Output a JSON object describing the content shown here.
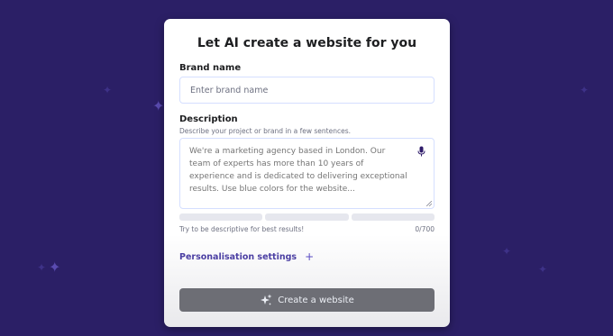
{
  "card": {
    "title": "Let AI create a website for you"
  },
  "brand": {
    "label": "Brand name",
    "placeholder": "Enter brand name",
    "value": ""
  },
  "description": {
    "label": "Description",
    "hint": "Describe your project or brand in a few sentences.",
    "placeholder": "We're a marketing agency based in London. Our team of experts has more than 10 years of experience and is dedicated to delivering exceptional results. Use blue colors for the website...",
    "helper": "Try to be descriptive for best results!",
    "counter": "0/700",
    "progress_segments_filled": 0,
    "progress_segments_total": 3
  },
  "personalisation": {
    "label": "Personalisation settings",
    "icon": "plus-icon"
  },
  "create_button": {
    "label": "Create a website",
    "icon": "sparkles-icon"
  },
  "colors": {
    "background": "#2b1f66",
    "accent": "#4b3fa3",
    "button_disabled": "#6d6e75"
  }
}
